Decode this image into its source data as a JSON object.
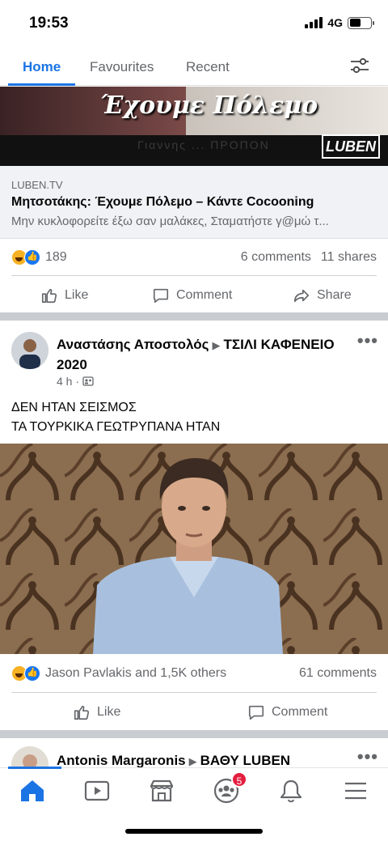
{
  "status_bar": {
    "time": "19:53",
    "network": "4G"
  },
  "tabs": [
    {
      "label": "Home",
      "active": true
    },
    {
      "label": "Favourites",
      "active": false
    },
    {
      "label": "Recent",
      "active": false
    }
  ],
  "post1": {
    "image_caption": "Έχουμε Πόλεμο",
    "image_strip_text": "Γιαννης ... ΠΡΟΠΟΝ",
    "image_logo": "LUBEN",
    "link": {
      "domain": "LUBEN.TV",
      "title": "Μητσοτάκης: Έχουμε Πόλεμο – Κάντε Cocooning",
      "description": "Μην κυκλοφορείτε έξω σαν μαλάκες, Σταματήστε γ@μώ τ..."
    },
    "reaction_count": "189",
    "comments": "6 comments",
    "shares": "11 shares",
    "actions": {
      "like": "Like",
      "comment": "Comment",
      "share": "Share"
    }
  },
  "post2": {
    "author": "Αναστάσης Αποστολός",
    "group_arrow": "▶",
    "group": "ΤΣΙΛΙ ΚΑΦΕΝΕΙΟ 2020",
    "time": "4 h ·",
    "text_line1": "ΔΕΝ ΗΤΑΝ ΣΕΙΣΜΟΣ",
    "text_line2": "ΤΑ ΤΟΥΡΚΙΚΑ ΓΕΩΤΡΥΠΑΝΑ ΗΤΑΝ",
    "reaction_text": "Jason Pavlakis and 1,5K others",
    "comments": "61 comments",
    "actions": {
      "like": "Like",
      "comment": "Comment"
    }
  },
  "post3": {
    "author": "Antonis Margaronis",
    "group_arrow": "▶",
    "group": "ΒΑΘΥ LUBEN"
  },
  "bottom_nav": {
    "items": [
      "home-icon",
      "video-icon",
      "marketplace-icon",
      "groups-icon",
      "notifications-icon",
      "menu-icon"
    ],
    "groups_badge": "5"
  },
  "colors": {
    "accent": "#1b74e4",
    "badge": "#e41e3f",
    "divider": "#c9ccd1"
  }
}
